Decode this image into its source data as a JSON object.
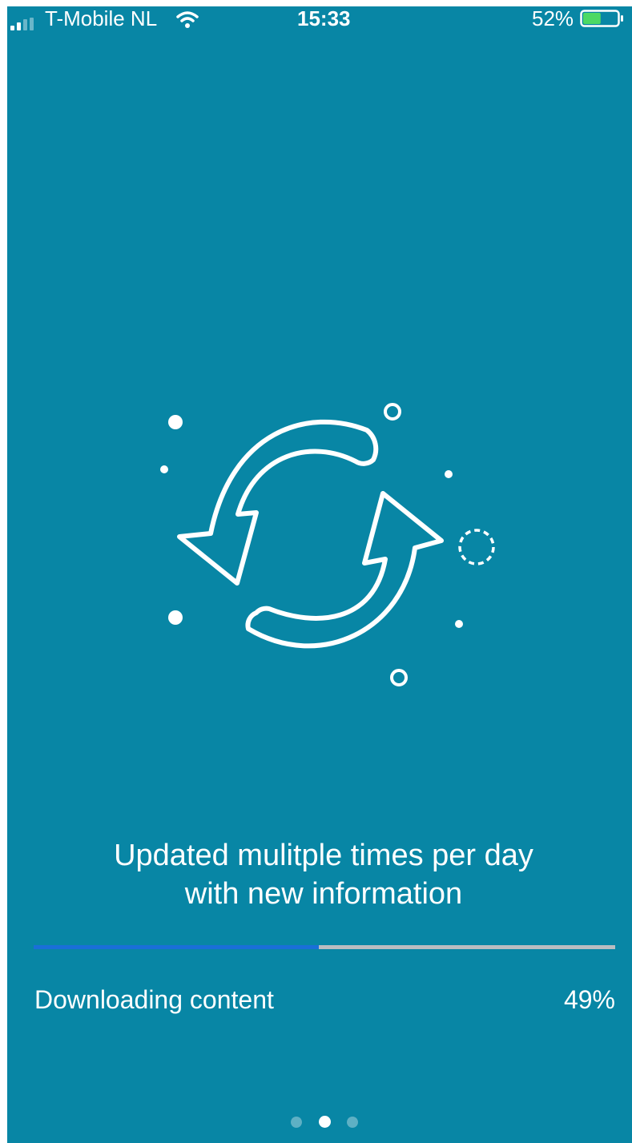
{
  "status_bar": {
    "carrier": "T-Mobile NL",
    "time": "15:33",
    "battery_percent": "52%",
    "battery_level": 0.52,
    "icons": [
      "signal-icon",
      "wifi-icon",
      "battery-icon"
    ]
  },
  "onboarding": {
    "illustration": "sync-arrows-icon",
    "headline_line1": "Updated mulitple times per day",
    "headline_line2": "with new information",
    "progress": {
      "label": "Downloading content",
      "percent_text": "49%",
      "value": 0.49,
      "fill_color": "#1a6fd8",
      "track_color": "#b9bdc1"
    },
    "page_indicator": {
      "count": 3,
      "current": 2
    }
  },
  "colors": {
    "background": "#0886a5",
    "foreground": "#ffffff"
  }
}
